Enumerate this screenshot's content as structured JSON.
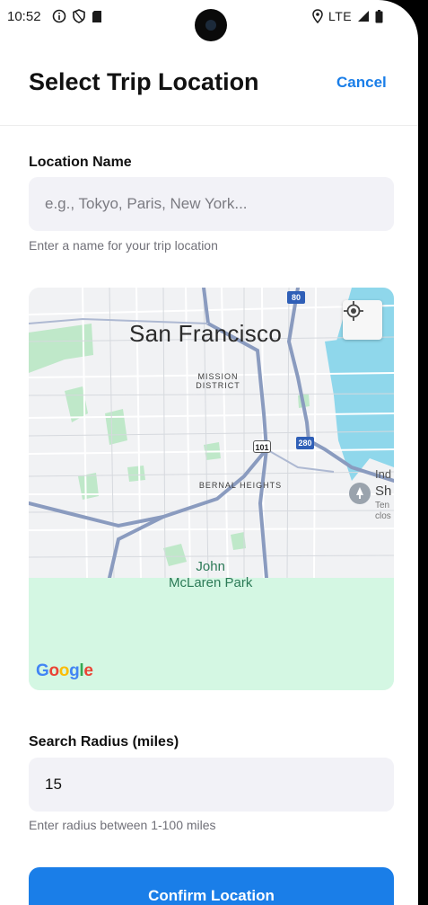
{
  "status_bar": {
    "time": "10:52",
    "network": "LTE"
  },
  "header": {
    "title": "Select Trip Location",
    "cancel_label": "Cancel"
  },
  "location_field": {
    "label": "Location Name",
    "value": "",
    "placeholder": "e.g., Tokyo, Paris, New York...",
    "helper": "Enter a name for your trip location"
  },
  "map": {
    "city": "San Francisco",
    "districts": [
      "MISSION DISTRICT",
      "BERNAL HEIGHTS"
    ],
    "park_line1": "John",
    "park_line2": "McLaren Park",
    "highway_shields": [
      "80",
      "101",
      "280"
    ],
    "poi_fragment_1": "Ind",
    "poi_fragment_2": "Sh",
    "poi_fragment_3": "Ten",
    "poi_fragment_4": "clos",
    "attribution": "Google",
    "colors": {
      "water": "#8fd7eb",
      "park": "#bfe8c9",
      "radius_overlay": "#d4f7e3",
      "highway": "#8a9bbf"
    }
  },
  "radius_field": {
    "label": "Search Radius (miles)",
    "value": "15",
    "helper": "Enter radius between 1-100 miles"
  },
  "confirm_label": "Confirm Location",
  "accent_color": "#1a7ee8"
}
